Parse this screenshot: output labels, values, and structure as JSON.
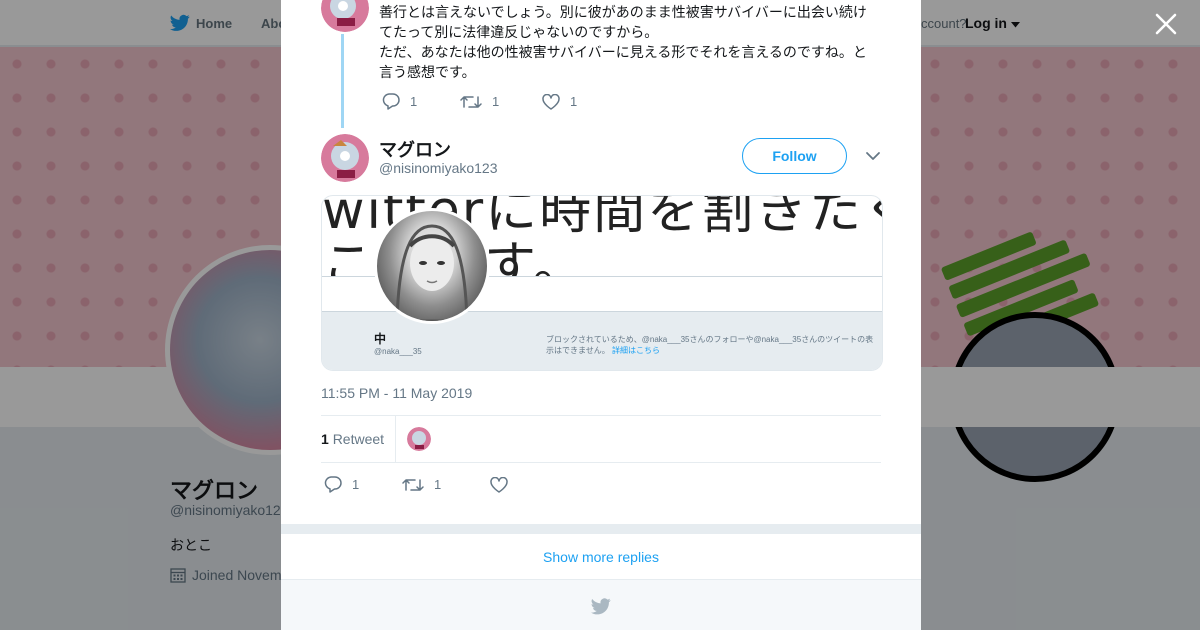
{
  "background": {
    "nav": {
      "home_label": "Home",
      "about_label": "Abo",
      "account_text": "ccount?",
      "login_label": "Log in"
    },
    "profile": {
      "name": "マグロン",
      "handle": "@nisinomiyako12",
      "bio": "おとこ",
      "joined": "Joined Novem"
    }
  },
  "modal": {
    "previous_tweet": {
      "lines": [
        "善行とは言えないでしょう。別に彼があのまま性被害サバイバーに出会い続け",
        "てたって別に法律違反じゃないのですから。",
        "ただ、あなたは他の性被害サバイバーに見える形でそれを言えるのですね。と",
        "言う感想です。"
      ],
      "replies": "1",
      "retweets": "1",
      "likes": "1"
    },
    "tweet": {
      "name": "マグロン",
      "handle": "@nisinomiyako123",
      "follow_label": "Follow",
      "media": {
        "big_text_top": "witterに時間を割きたく",
        "big_text_bottom": "こします。",
        "blocked_name": "中",
        "blocked_handle": "@naka___35",
        "blocked_message": "ブロックされているため、@naka___35さんのフォローや@naka___35さんのツイートの表示はできません。",
        "blocked_link": "詳細はこちら"
      },
      "timestamp": "11:55 PM - 11 May 2019",
      "retweet_count": "1",
      "retweet_label": "Retweet",
      "replies": "1",
      "retweets": "1"
    },
    "show_more_label": "Show more replies"
  },
  "colors": {
    "accent": "#1da1f2",
    "thread_line": "#9fd6f4",
    "muted": "#657786",
    "like_heart": "#657786"
  },
  "icons": [
    "twitter-bird-icon",
    "close-icon",
    "reply-icon",
    "retweet-icon",
    "heart-icon",
    "chevron-down-icon",
    "calendar-icon",
    "caret-down-icon"
  ]
}
